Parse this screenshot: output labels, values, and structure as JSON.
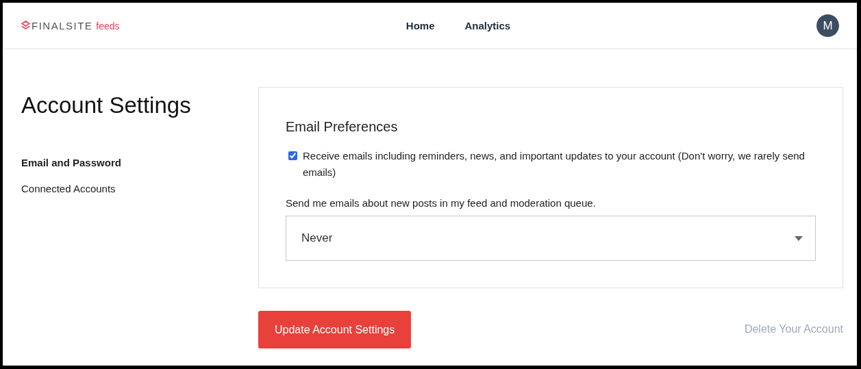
{
  "logo": {
    "name": "FINALSITE",
    "suffix": "feeds"
  },
  "nav": [
    {
      "label": "Home",
      "selected": false
    },
    {
      "label": "Analytics",
      "selected": false
    }
  ],
  "avatar": {
    "initial": "M"
  },
  "page_title": "Account Settings",
  "sidebar": {
    "items": [
      {
        "label": "Email and Password",
        "selected": true
      },
      {
        "label": "Connected Accounts",
        "selected": false
      }
    ]
  },
  "email_preferences": {
    "title": "Email Preferences",
    "checkbox": {
      "label": "Receive emails including reminders, news, and important updates to your account (Don't worry, we rarely send emails)",
      "checked": true
    },
    "frequency_label": "Send me emails about new posts in my feed and moderation queue.",
    "frequency_select": {
      "value": "Never"
    }
  },
  "buttons": {
    "update": "Update Account Settings",
    "delete": "Delete Your Account"
  }
}
